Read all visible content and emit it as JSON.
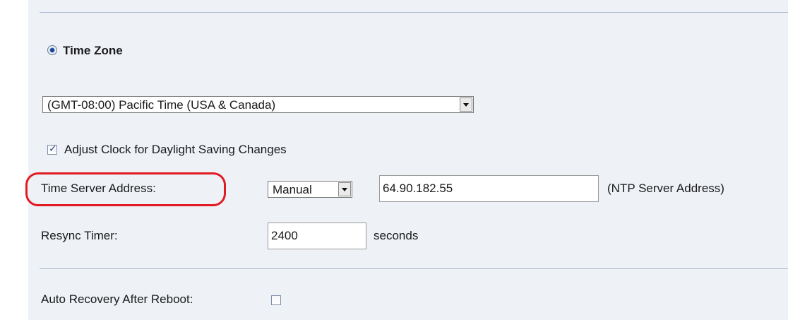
{
  "time_zone": {
    "radio_label": "Time Zone",
    "selected": "(GMT-08:00) Pacific Time (USA & Canada)"
  },
  "daylight_saving": {
    "label": "Adjust Clock for Daylight Saving Changes",
    "checked": true
  },
  "time_server": {
    "label": "Time Server Address:",
    "mode": "Manual",
    "address": "64.90.182.55",
    "hint": "(NTP Server Address)"
  },
  "resync": {
    "label": "Resync Timer:",
    "value": "2400",
    "unit": "seconds"
  },
  "auto_recovery": {
    "label": "Auto Recovery After Reboot:",
    "checked": false
  },
  "colors": {
    "panel_background": "#eef1f6",
    "divider": "#a8b6cf",
    "highlight_ring": "#e01b22"
  }
}
